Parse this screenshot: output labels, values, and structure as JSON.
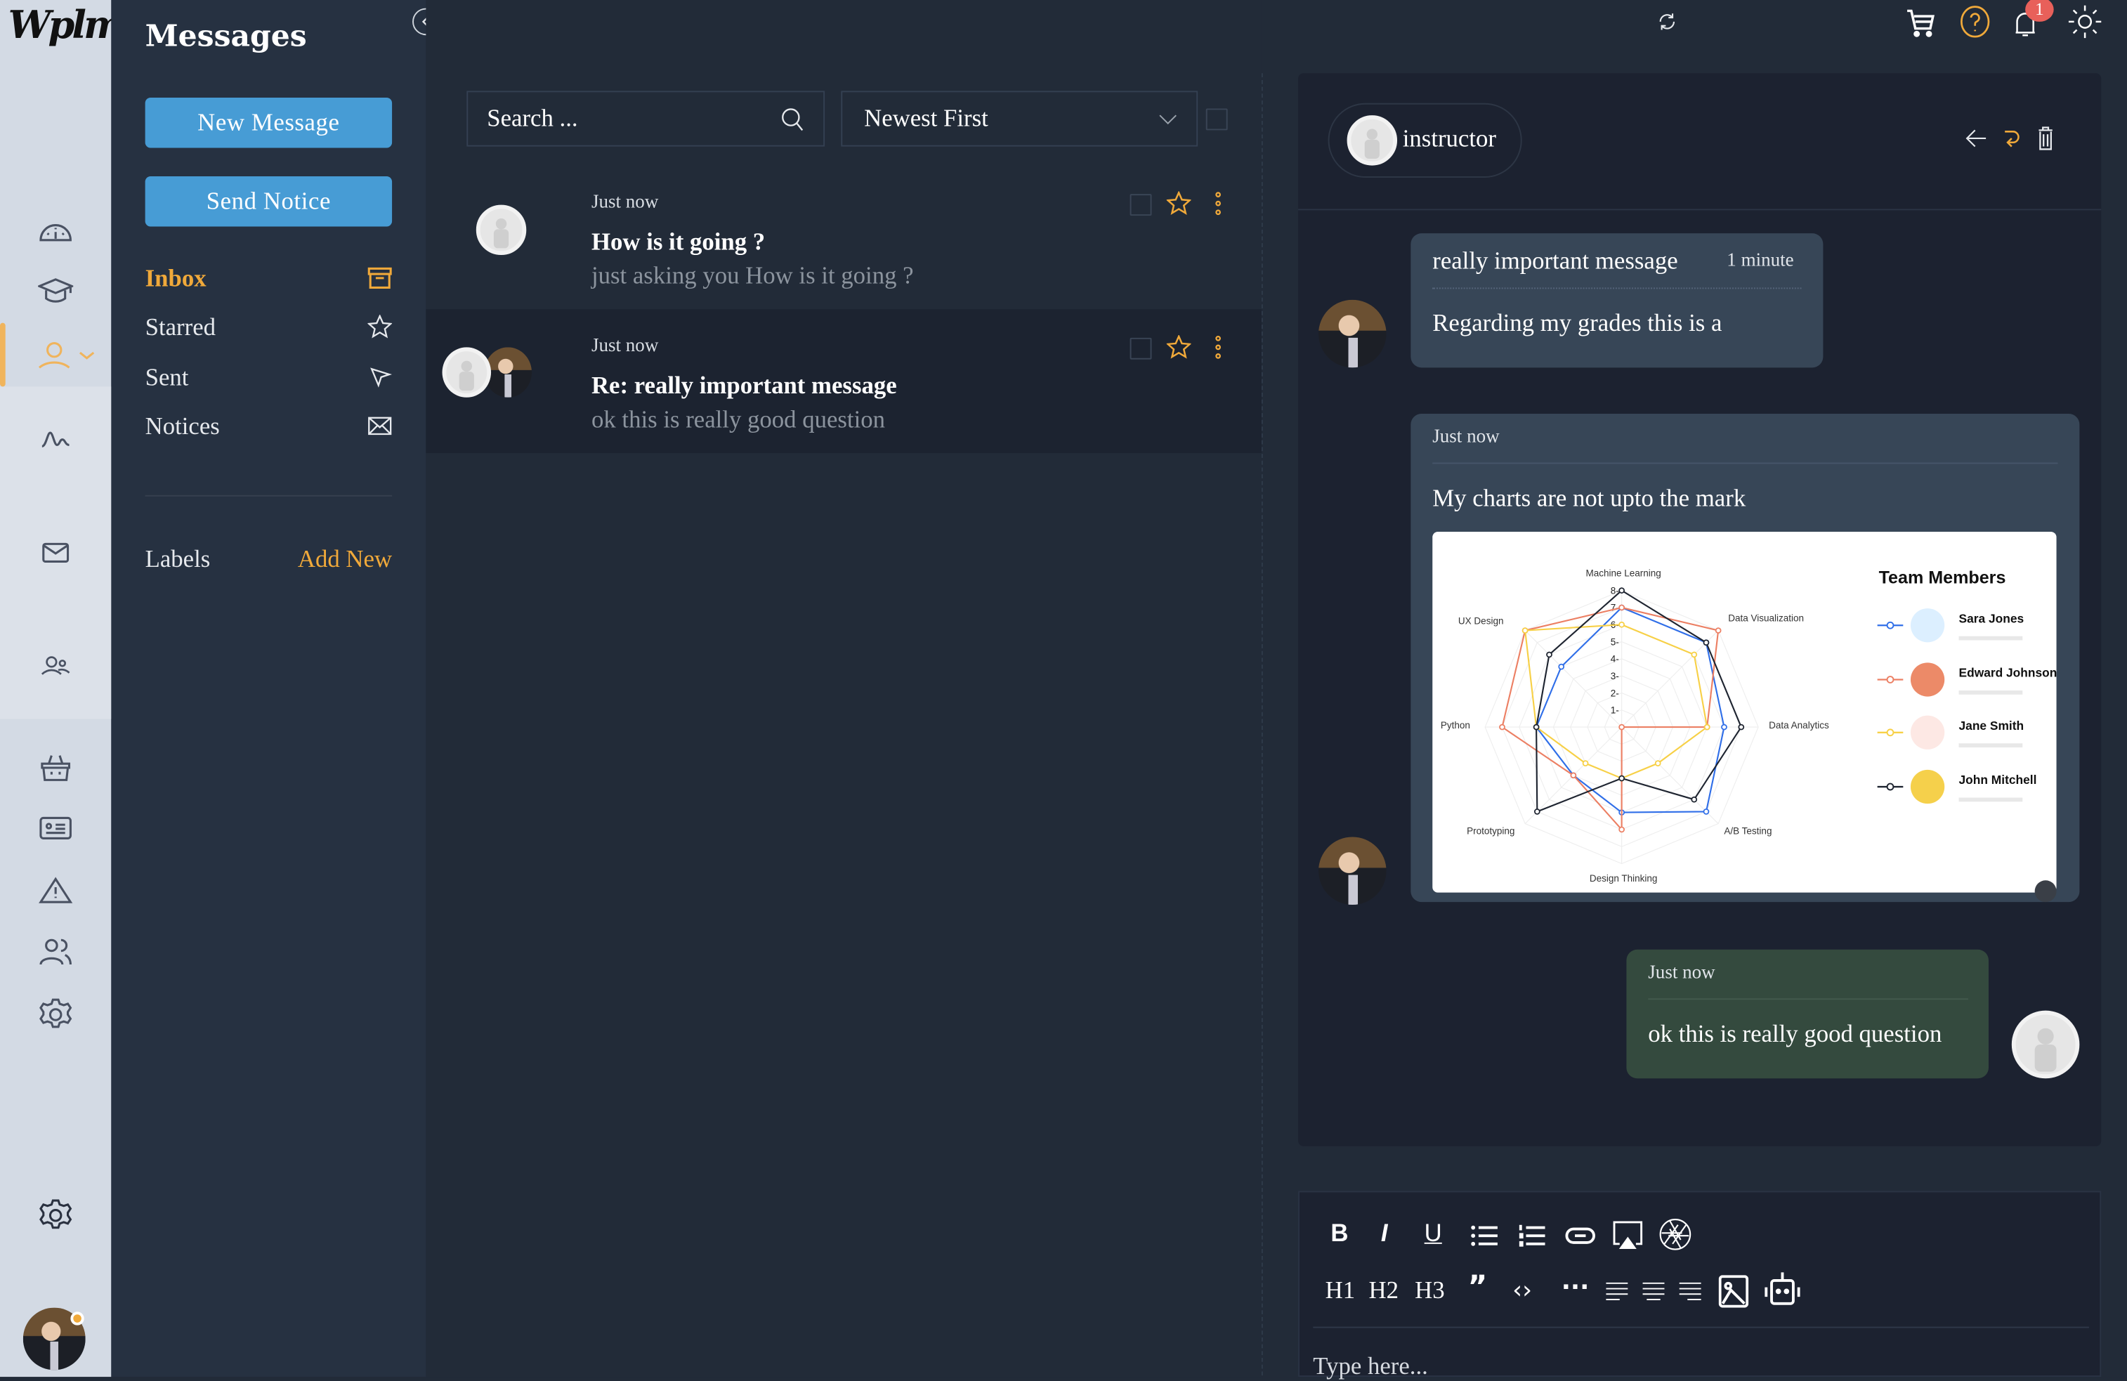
{
  "brand": {
    "logo_text": "Wplms"
  },
  "rail": {
    "icons": [
      "dashboard-icon",
      "graduation-cap-icon",
      "user-icon",
      "activity-icon",
      "mail-icon",
      "group-icon",
      "basket-icon",
      "id-card-icon",
      "warning-icon",
      "users-icon",
      "gear-icon",
      "settings-icon"
    ],
    "active": "user-icon",
    "accent": "#f0b45c"
  },
  "sidebar": {
    "title": "Messages",
    "new_message": "New Message",
    "send_notice": "Send Notice",
    "folders": [
      {
        "label": "Inbox",
        "icon": "archive-box-icon",
        "selected": true
      },
      {
        "label": "Starred",
        "icon": "star-icon"
      },
      {
        "label": "Sent",
        "icon": "send-arrow-icon"
      },
      {
        "label": "Notices",
        "icon": "envelope-icon"
      }
    ],
    "labels_title": "Labels",
    "add_new": "Add New"
  },
  "list": {
    "search_placeholder": "Search ...",
    "sort_value": "Newest First",
    "messages": [
      {
        "time": "Just now",
        "subject": "How is it going ?",
        "preview": "just asking you How is it going ?"
      },
      {
        "time": "Just now",
        "subject": "Re: really important message",
        "preview": "ok this is really good question",
        "selected": true
      }
    ]
  },
  "topbar": {
    "notification_count": "1",
    "icons": [
      "refresh-icon",
      "cart-icon",
      "help-icon",
      "bell-icon",
      "sun-icon"
    ]
  },
  "thread": {
    "participant": "instructor",
    "messages": [
      {
        "subject": "really important message",
        "time": "1 minute",
        "body": "Regarding my grades this is a"
      },
      {
        "time": "Just now",
        "body": "My charts are not upto the mark"
      },
      {
        "time": "Just now",
        "body": "ok this is really good question",
        "own": true
      }
    ]
  },
  "attachment_chart": {
    "type": "radar",
    "axes": [
      "Machine Learning",
      "Data Visualization",
      "Data Analytics",
      "A/B Testing",
      "Design Thinking",
      "Prototyping",
      "Python",
      "UX Design"
    ],
    "ticks": [
      "1",
      "2",
      "3",
      "4",
      "5",
      "6",
      "7",
      "8"
    ],
    "max": 8,
    "legend_title": "Team Members",
    "series": [
      {
        "name": "Sara Jones",
        "color": "#2f6ee8",
        "avatar_bg": "#dcefff",
        "values": [
          7,
          7,
          6,
          7,
          5,
          4,
          5,
          5
        ]
      },
      {
        "name": "Edward Johnson",
        "color": "#ec7f63",
        "avatar_bg": "#ec8a68",
        "values": [
          7,
          8,
          5,
          0,
          6,
          4,
          7,
          8
        ]
      },
      {
        "name": "Jane Smith",
        "color": "#f7d046",
        "avatar_bg": "#fde8e4",
        "values": [
          6,
          6,
          5,
          3,
          3,
          3,
          5,
          8
        ]
      },
      {
        "name": "John Mitchell",
        "color": "#1e2430",
        "avatar_bg": "#f5d04b",
        "values": [
          8,
          7,
          7,
          6,
          3,
          7,
          5,
          6
        ]
      }
    ]
  },
  "editor": {
    "tools_row1": [
      "bold-icon",
      "italic-icon",
      "underline-icon",
      "bullet-list-icon",
      "numbered-list-icon",
      "link-icon",
      "embed-icon",
      "aperture-icon"
    ],
    "headings": [
      "H1",
      "H2",
      "H3"
    ],
    "tools_row2": [
      "quote-icon",
      "code-icon",
      "more-icon",
      "align-left-icon",
      "align-center-icon",
      "align-right-icon",
      "image-icon",
      "bot-icon"
    ],
    "placeholder": "Type here..."
  }
}
